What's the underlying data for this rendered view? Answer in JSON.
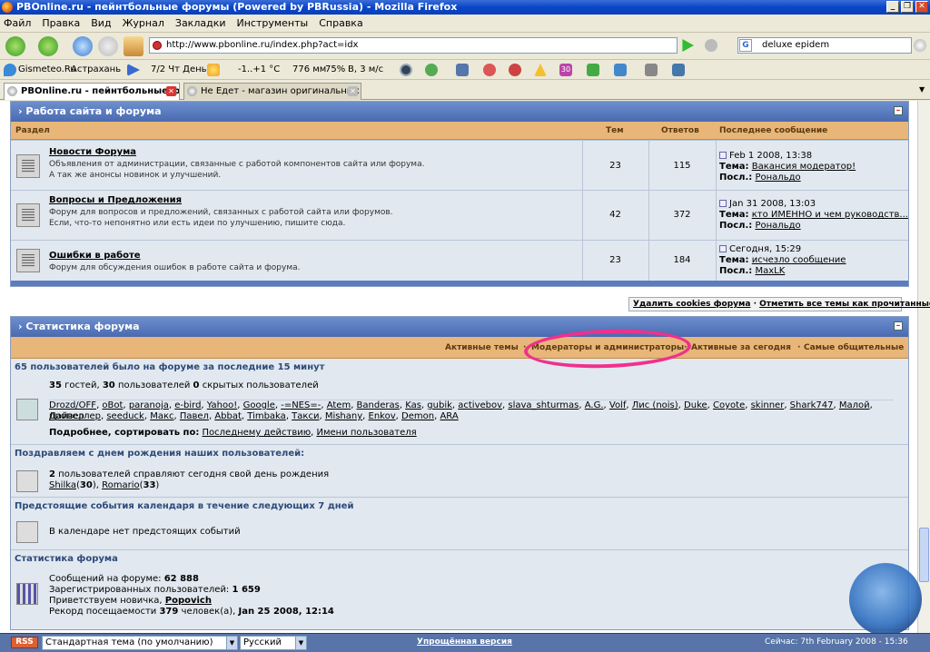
{
  "window": {
    "title": "PBOnline.ru - пейнтбольные форумы (Powered by PBRussia) - Mozilla Firefox"
  },
  "menu": [
    "Файл",
    "Правка",
    "Вид",
    "Журнал",
    "Закладки",
    "Инструменты",
    "Справка"
  ],
  "nav": {
    "url": "http://www.pbonline.ru/index.php?act=idx",
    "search": "deluxe epidem"
  },
  "toolbar": {
    "gismeteo": "Gismeteo.Ru",
    "city": "Астрахань",
    "day": "7/2 Чт День",
    "temp": "-1..+1 °C",
    "pressure": "776 мм",
    "humidity": "75%",
    "wind": "В, 3 м/с"
  },
  "tabs": [
    {
      "label": "PBOnline.ru - пейнтбольные фор...",
      "active": true
    },
    {
      "label": "Не Едет - магазин оригинальных ав...",
      "active": false
    }
  ],
  "forum_block": {
    "title": "Работа сайта и форума",
    "headers": {
      "section": "Раздел",
      "topics": "Тем",
      "replies": "Ответов",
      "last": "Последнее сообщение"
    },
    "rows": [
      {
        "name": "Новости Форума",
        "desc1": "Объявления от администрации, связанные с работой компонентов сайта или форума.",
        "desc2": "А так же анонсы новинок и улучшений.",
        "topics": "23",
        "replies": "115",
        "date": "Feb 1 2008, 13:38",
        "topic_label": "Тема:",
        "topic": "Вакансия модератор!",
        "by_label": "Посл.:",
        "by": "Рональдо"
      },
      {
        "name": "Вопросы и Предложения",
        "desc1": "Форум для вопросов и предложений, связанных с работой сайта или форумов.",
        "desc2": "Если, что-то непонятно или есть идеи по улучшению, пишите сюда.",
        "topics": "42",
        "replies": "372",
        "date": "Jan 31 2008, 13:03",
        "topic_label": "Тема:",
        "topic": "кто ИМЕННО и чем руководств...",
        "by_label": "Посл.:",
        "by": "Рональдо"
      },
      {
        "name": "Ошибки в работе",
        "desc1": "Форум для обсуждения ошибок в работе сайта и форума.",
        "desc2": "",
        "topics": "23",
        "replies": "184",
        "date": "Сегодня, 15:29",
        "topic_label": "Тема:",
        "topic": "исчезло сообщение",
        "by_label": "Посл.:",
        "by": "MaxLK"
      }
    ]
  },
  "cookies": {
    "delete": "Удалить cookies форума",
    "sep": " · ",
    "mark": "Отметить все темы как прочитанные"
  },
  "stats_block": {
    "title": "Статистика форума",
    "links": {
      "active_topics": "Активные темы",
      "moderators": "Модераторы и администраторы",
      "active_today": "Активные за сегодня",
      "most_active": "Самые общительные"
    },
    "online_title": "65 пользователей было на форуме за последние 15 минут",
    "online_counts": {
      "guests": "35",
      "guests_label": "гостей,",
      "users": "30",
      "users_label": "пользователей",
      "hidden": "0",
      "hidden_label": "скрытых пользователей"
    },
    "users_line1": [
      "Drozd/OFF",
      "oBot",
      "paranoja",
      "e-bird",
      "Yahoo!",
      "Google",
      "-=NES=-",
      "Atem",
      "Banderas",
      "Kas",
      "gubik",
      "activebov",
      "slava_shturmas",
      "A.G.",
      "Volf",
      "Лис (nois)",
      "Duke",
      "Coyote",
      "skinner",
      "Shark747",
      "Малой",
      "Дайвер"
    ],
    "users_line2": [
      "пропеллер",
      "seeduck",
      "Макс",
      "Павел",
      "Abbat",
      "Timbaka",
      "Такси",
      "Mishany",
      "Enkov",
      "Demon",
      "ARA"
    ],
    "sort_label": "Подробнее, сортировать по:",
    "sort_action": "Последнему действию",
    "sort_name": "Имени пользователя",
    "birthday_title": "Поздравляем с днем рождения наших пользователей:",
    "birthday_count": "2",
    "birthday_text": "пользователей справляют сегодня свой день рождения",
    "birthday_users": [
      {
        "name": "Shilka",
        "age": "30"
      },
      {
        "name": "Romario",
        "age": "33"
      }
    ],
    "calendar_title": "Предстоящие события календаря в течение следующих 7 дней",
    "calendar_text": "В календаре нет предстоящих событий",
    "stats_title": "Статистика форума",
    "posts_label": "Сообщений на форуме:",
    "posts": "62 888",
    "registered_label": "Зарегистрированных пользователей:",
    "registered": "1 659",
    "newest_label": "Приветствуем новичка,",
    "newest": "Popovich",
    "record_label": "Рекорд посещаемости",
    "record": "379",
    "record_text": "человек(а),",
    "record_date": "Jan 25 2008, 12:14"
  },
  "statusbar": {
    "rss": "RSS",
    "theme": "Стандартная тема (по умолчанию)",
    "lang": "Русский",
    "simple": "Упрощённая версия",
    "now": "Сейчас: 7th February 2008 - 15:36"
  },
  "colors": {
    "accent": "#4a6ab0",
    "subhead": "#e8b678",
    "highlight": "#f0308c"
  }
}
